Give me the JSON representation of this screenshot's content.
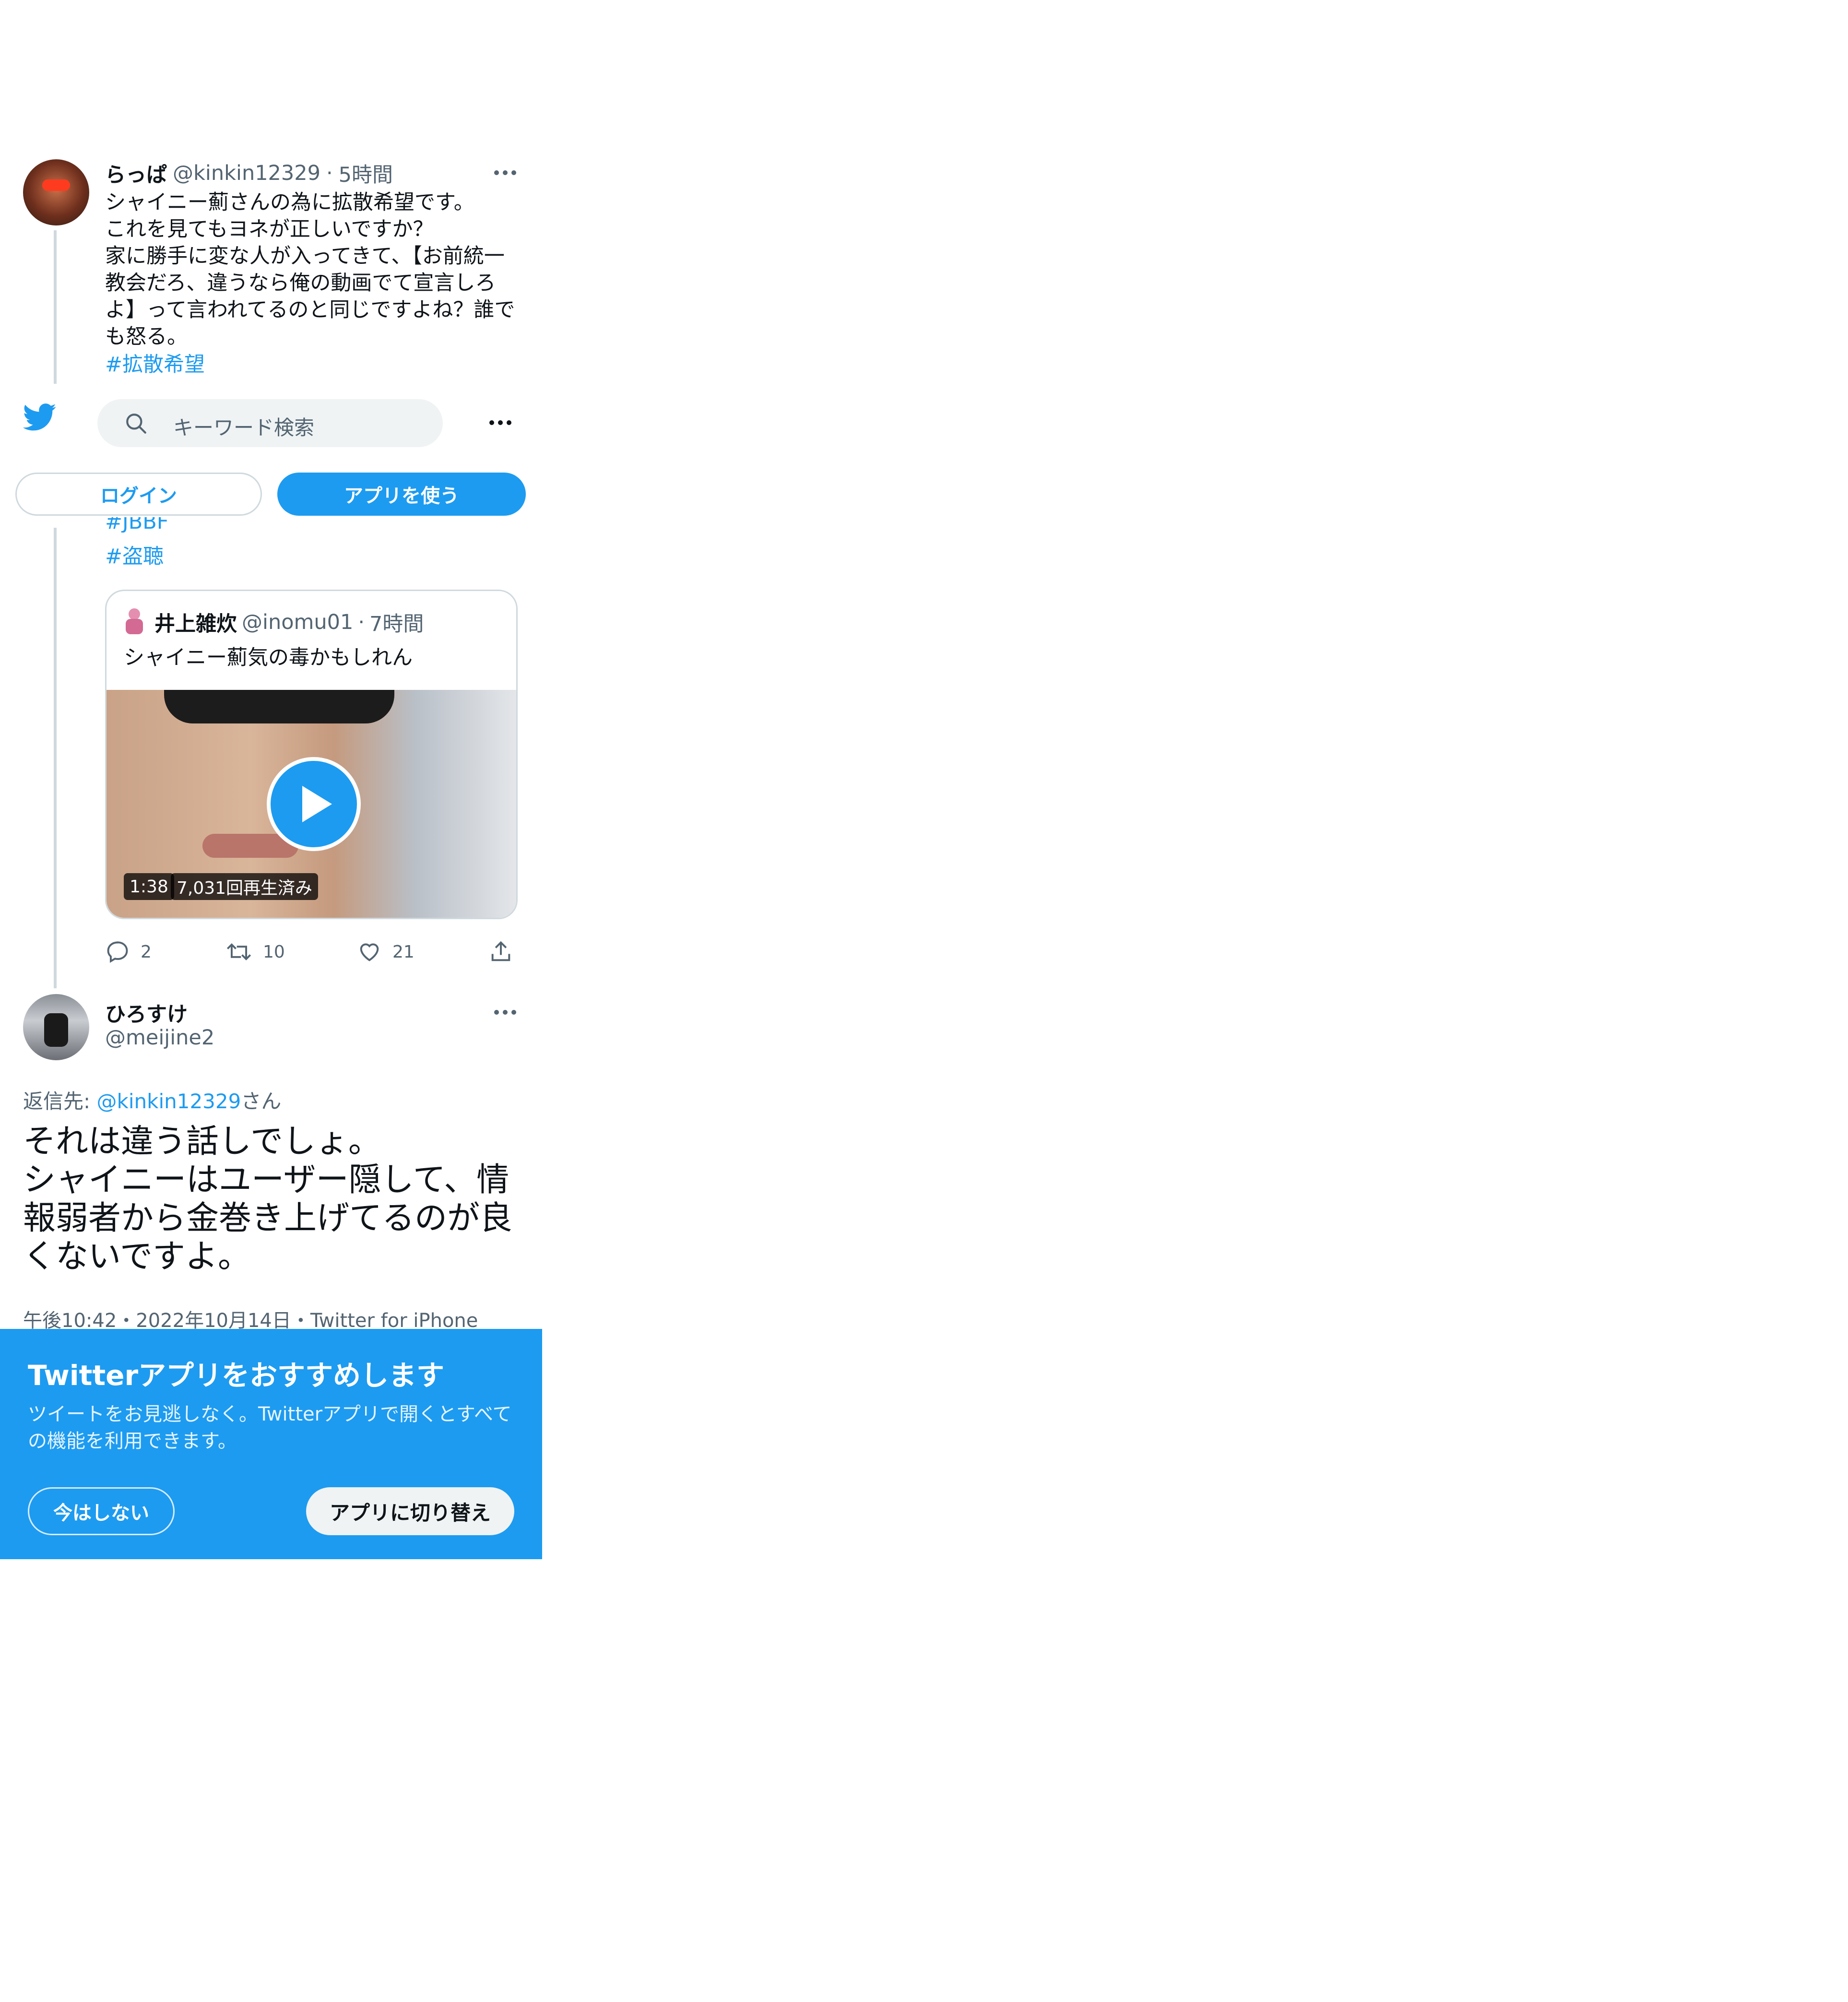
{
  "header": {
    "search_placeholder": "キーワード検索",
    "login_label": "ログイン",
    "use_app_label": "アプリを使う"
  },
  "tweet1": {
    "author_name": "らっぱ",
    "handle": "@kinkin12329",
    "time": "5時間",
    "text": "シャイニー薊さんの為に拡散希望です。\nこれを見てもヨネが正しいですか？\n家に勝手に変な人が入ってきて、【お前統一\n教会だろ、違うなら俺の動画でて宣言しろ\nよ】って言われてるのと同じですよね？誰で\nも怒る。",
    "hashtags": [
      "#拡散希望",
      "#JBBF",
      "#盗聴"
    ]
  },
  "quote": {
    "author_name": "井上雑炊",
    "handle": "@inomu01",
    "time": "7時間",
    "text": "シャイニー薊気の毒かもしれん",
    "video_duration": "1:38",
    "video_views": "7,031回再生済み"
  },
  "tweet1_actions": {
    "replies": "2",
    "retweets": "10",
    "likes": "21"
  },
  "tweet2": {
    "author_name": "ひろすけ",
    "handle": "@meijine2",
    "reply_prefix": "返信先: ",
    "reply_to": "@kinkin12329",
    "reply_suffix": "さん",
    "text": "それは違う話しでしょ。\nシャイニーはユーザー隠して、情\n報弱者から金巻き上げてるのが良\nくないですよ。",
    "meta": "午後10:42・2022年10月14日・Twitter for iPhone"
  },
  "promo": {
    "title": "Twitterアプリをおすすめします",
    "description": "ツイートをお見逃しなく。Twitterアプリで開くとすべての機能を利用できます。",
    "not_now_label": "今はしない",
    "switch_label": "アプリに切り替え"
  },
  "colors": {
    "accent": "#1d9bf0",
    "text": "#0f1419",
    "secondary": "#536471"
  }
}
